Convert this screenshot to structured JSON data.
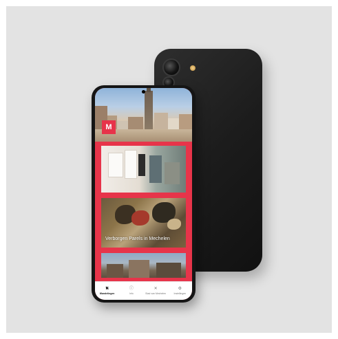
{
  "status_bar": {
    "left": "",
    "right": ""
  },
  "app": {
    "logo_text": "M"
  },
  "cards": [
    {
      "title": ""
    },
    {
      "title": "Verborgen Parels in Mechelen"
    },
    {
      "title": ""
    }
  ],
  "tabbar": {
    "tabs": [
      {
        "label": "Wandelingen",
        "icon": "map-icon",
        "glyph": "⛕",
        "active": true
      },
      {
        "label": "Info",
        "icon": "info-icon",
        "glyph": "ⓘ",
        "active": false
      },
      {
        "label": "Stad van Mechelen",
        "icon": "compass-icon",
        "glyph": "✕",
        "active": false
      },
      {
        "label": "Instellingen",
        "icon": "settings-icon",
        "glyph": "⚙",
        "active": false
      }
    ]
  },
  "colors": {
    "accent": "#e7344a",
    "backdrop": "#e3e3e3",
    "phone_body": "#151515"
  }
}
